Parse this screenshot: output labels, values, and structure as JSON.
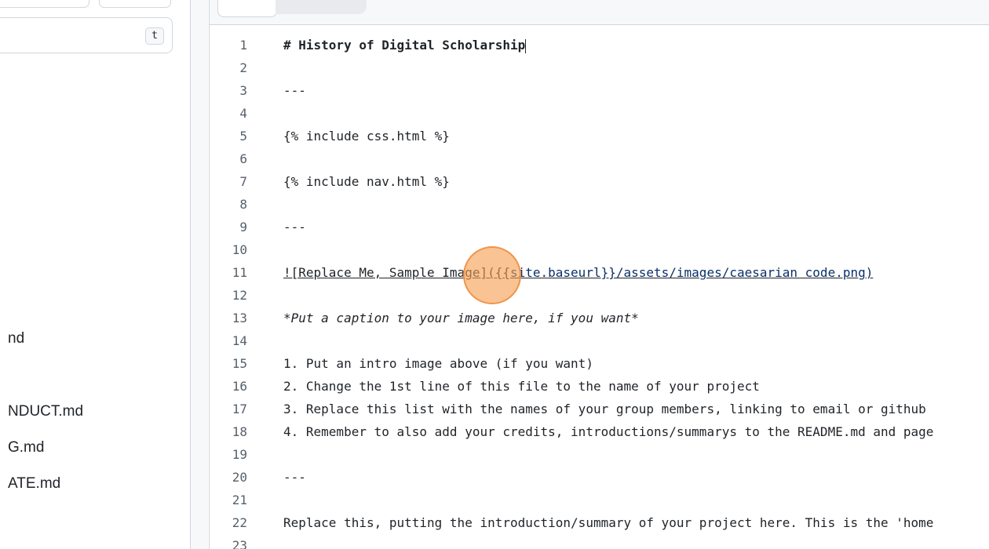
{
  "sidebar": {
    "search_shortcut": "t",
    "files": [
      "nd",
      "NDUCT.md",
      "G.md",
      "ATE.md"
    ]
  },
  "editor": {
    "lines": [
      {
        "n": "1",
        "text": "# History of Digital Scholarship",
        "style": "bold",
        "caret": true
      },
      {
        "n": "2",
        "text": ""
      },
      {
        "n": "3",
        "text": "---"
      },
      {
        "n": "4",
        "text": ""
      },
      {
        "n": "5",
        "text": "{% include css.html %}"
      },
      {
        "n": "6",
        "text": ""
      },
      {
        "n": "7",
        "text": "{% include nav.html %}"
      },
      {
        "n": "8",
        "text": ""
      },
      {
        "n": "9",
        "text": "---"
      },
      {
        "n": "10",
        "text": ""
      },
      {
        "n": "11",
        "text": "",
        "link_prefix": "![Replace Me, Sample Image]({{",
        "link_url": "site.baseurl",
        "link_suffix": "}}/assets/images/caesarian code.png)",
        "style": "link"
      },
      {
        "n": "12",
        "text": ""
      },
      {
        "n": "13",
        "text": "*Put a caption to your image here, if you want*",
        "style": "italic"
      },
      {
        "n": "14",
        "text": ""
      },
      {
        "n": "15",
        "text": "1. Put an intro image above (if you want)"
      },
      {
        "n": "16",
        "text": "2. Change the 1st line of this file to the name of your project"
      },
      {
        "n": "17",
        "text": "3. Replace this list with the names of your group members, linking to email or github"
      },
      {
        "n": "18",
        "text": "4. Remember to also add your credits, introductions/summarys to the README.md and page"
      },
      {
        "n": "19",
        "text": ""
      },
      {
        "n": "20",
        "text": "---"
      },
      {
        "n": "21",
        "text": ""
      },
      {
        "n": "22",
        "text": "Replace this, putting the introduction/summary of your project here. This is the 'home"
      },
      {
        "n": "23",
        "text": ""
      }
    ]
  },
  "colors": {
    "accent_cursor": "#f59e50",
    "link": "#0a3069",
    "line_number": "#57606a"
  }
}
